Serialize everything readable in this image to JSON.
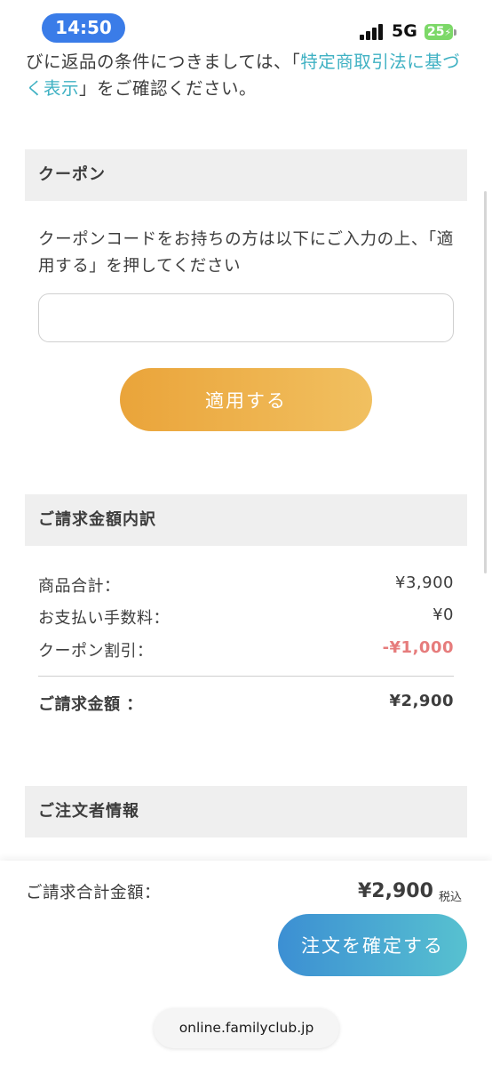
{
  "status": {
    "time": "14:50",
    "network": "5G",
    "battery": "25"
  },
  "notice": {
    "prefix": "びに返品の条件につきましては、「",
    "link": "特定商取引法に基づく表示",
    "suffix": "」をご確認ください。"
  },
  "coupon": {
    "title": "クーポン",
    "description": "クーポンコードをお持ちの方は以下にご入力の上、「適用する」を押してください",
    "input_value": "",
    "apply_label": "適用する"
  },
  "billing": {
    "title": "ご請求金額内訳",
    "rows": [
      {
        "label": "商品合計：",
        "value": "¥3,900"
      },
      {
        "label": "お支払い手数料：",
        "value": "¥0"
      },
      {
        "label": "クーポン割引：",
        "value": "-¥1,000"
      }
    ],
    "total_label": "ご請求金額 ：",
    "total_value": "¥2,900"
  },
  "orderer": {
    "title": "ご注文者情報"
  },
  "footer": {
    "total_label": "ご請求合計金額：",
    "total_amount": "¥2,900",
    "tax_label": "税込",
    "order_label": "注文を確定する"
  },
  "browser": {
    "url": "online.familyclub.jp"
  },
  "colors": {
    "apply_button": "#eaa43a",
    "order_button": "#3c8fd3",
    "link": "#3fb1c3",
    "discount": "#e67c7c"
  }
}
